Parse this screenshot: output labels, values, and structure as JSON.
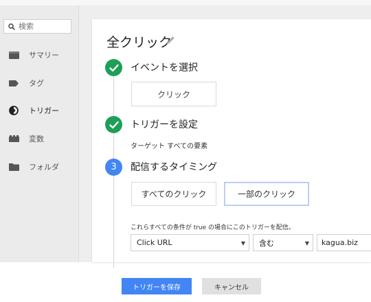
{
  "sidebar": {
    "search": {
      "placeholder": "検索",
      "icon": "search-icon"
    },
    "items": [
      {
        "label": "サマリー",
        "icon": "summary-icon"
      },
      {
        "label": "タグ",
        "icon": "tag-icon"
      },
      {
        "label": "トリガー",
        "icon": "trigger-icon",
        "active": true
      },
      {
        "label": "変数",
        "icon": "variables-icon"
      },
      {
        "label": "フォルダ",
        "icon": "folder-icon"
      }
    ]
  },
  "main": {
    "title": "全クリック",
    "edit_icon": "pencil-icon",
    "steps": [
      {
        "status": "done",
        "icon": "check-icon",
        "title": "イベントを選択",
        "button_label": "クリック"
      },
      {
        "status": "done",
        "icon": "check-icon",
        "title": "トリガーを設定",
        "target_text": "ターゲット すべての要素"
      },
      {
        "number": "3",
        "title": "配信するタイミング",
        "option_all": "すべてのクリック",
        "option_some": "一部のクリック",
        "selected": "一部のクリック"
      }
    ],
    "condition": {
      "text": "これらすべての条件が true の場合にこのトリガーを配信。",
      "variable": "Click URL",
      "operator": "含む",
      "value": "kagua.biz"
    }
  },
  "footer": {
    "save_label": "トリガーを保存",
    "cancel_label": "キャンセル"
  },
  "colors": {
    "check_green": "#1e9f58",
    "step_blue": "#4285f4",
    "save_button": "#4285f4"
  }
}
